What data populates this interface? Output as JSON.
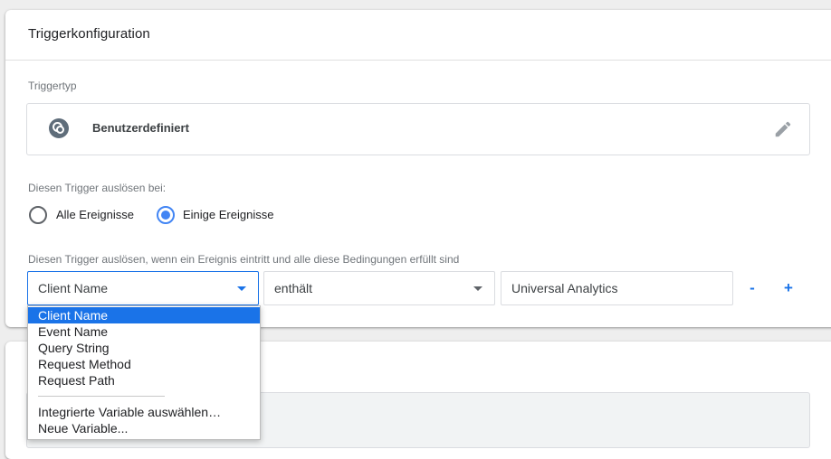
{
  "card": {
    "title": "Triggerkonfiguration",
    "trigger_type_label": "Triggertyp",
    "trigger_type_name": "Benutzerdefiniert",
    "fire_on_label": "Diesen Trigger auslösen bei:",
    "radio_options": [
      {
        "label": "Alle Ereignisse",
        "checked": false
      },
      {
        "label": "Einige Ereignisse",
        "checked": true
      }
    ],
    "conditions_label": "Diesen Trigger auslösen, wenn ein Ereignis eintritt und alle diese Bedingungen erfüllt sind",
    "condition": {
      "variable": "Client Name",
      "operator": "enthält",
      "value": "Universal Analytics"
    },
    "remove_label": "-",
    "add_label": "+"
  },
  "dropdown": {
    "items": [
      "Client Name",
      "Event Name",
      "Query String",
      "Request Method",
      "Request Path"
    ],
    "selected": "Client Name",
    "extra_items": [
      "Integrierte Variable auswählen…",
      "Neue Variable..."
    ]
  },
  "colors": {
    "accent": "#1a73e8",
    "radio_checked": "#4285f4",
    "icon": "#5f6d7a"
  },
  "icons": {
    "trigger_type": "custom-event-icon",
    "edit": "pencil-icon",
    "dropdown": "caret-down-icon"
  }
}
